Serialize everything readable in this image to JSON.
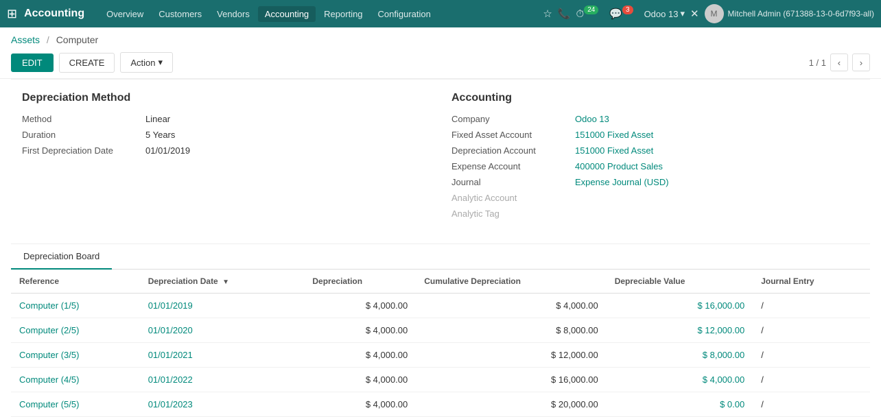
{
  "nav": {
    "brand": "Accounting",
    "links": [
      "Overview",
      "Customers",
      "Vendors",
      "Accounting",
      "Reporting",
      "Configuration"
    ],
    "active_link": "Accounting",
    "odoo_version": "Odoo 13",
    "user_name": "Mitchell Admin (671388-13-0-6d7f93-all)",
    "notification_count": "24",
    "message_count": "3"
  },
  "breadcrumb": {
    "parent": "Assets",
    "current": "Computer"
  },
  "toolbar": {
    "edit_label": "EDIT",
    "create_label": "CREATE",
    "action_label": "Action",
    "pagination": "1 / 1"
  },
  "depreciation_method": {
    "title": "Depreciation Method",
    "fields": {
      "method_label": "Method",
      "method_value": "Linear",
      "duration_label": "Duration",
      "duration_value": "5 Years",
      "first_date_label": "First Depreciation Date",
      "first_date_value": "01/01/2019"
    }
  },
  "accounting": {
    "title": "Accounting",
    "fields": {
      "company_label": "Company",
      "company_value": "Odoo 13",
      "fixed_asset_label": "Fixed Asset Account",
      "fixed_asset_value": "151000 Fixed Asset",
      "depreciation_account_label": "Depreciation Account",
      "depreciation_account_value": "151000 Fixed Asset",
      "expense_account_label": "Expense Account",
      "expense_account_value": "400000 Product Sales",
      "journal_label": "Journal",
      "journal_value": "Expense Journal (USD)",
      "analytic_account_label": "Analytic Account",
      "analytic_account_value": "",
      "analytic_tag_label": "Analytic Tag",
      "analytic_tag_value": ""
    }
  },
  "tab": {
    "label": "Depreciation Board"
  },
  "table": {
    "columns": [
      {
        "key": "reference",
        "label": "Reference",
        "align": "left"
      },
      {
        "key": "depreciation_date",
        "label": "Depreciation Date",
        "align": "left",
        "sorted": true
      },
      {
        "key": "depreciation",
        "label": "Depreciation",
        "align": "right"
      },
      {
        "key": "cumulative",
        "label": "Cumulative Depreciation",
        "align": "right"
      },
      {
        "key": "depreciable",
        "label": "Depreciable Value",
        "align": "right"
      },
      {
        "key": "journal_entry",
        "label": "Journal Entry",
        "align": "left"
      }
    ],
    "rows": [
      {
        "reference": "Computer (1/5)",
        "depreciation_date": "01/01/2019",
        "depreciation": "$ 4,000.00",
        "cumulative": "$ 4,000.00",
        "depreciable": "$ 16,000.00",
        "journal_entry": "/"
      },
      {
        "reference": "Computer (2/5)",
        "depreciation_date": "01/01/2020",
        "depreciation": "$ 4,000.00",
        "cumulative": "$ 8,000.00",
        "depreciable": "$ 12,000.00",
        "journal_entry": "/"
      },
      {
        "reference": "Computer (3/5)",
        "depreciation_date": "01/01/2021",
        "depreciation": "$ 4,000.00",
        "cumulative": "$ 12,000.00",
        "depreciable": "$ 8,000.00",
        "journal_entry": "/"
      },
      {
        "reference": "Computer (4/5)",
        "depreciation_date": "01/01/2022",
        "depreciation": "$ 4,000.00",
        "cumulative": "$ 16,000.00",
        "depreciable": "$ 4,000.00",
        "journal_entry": "/"
      },
      {
        "reference": "Computer (5/5)",
        "depreciation_date": "01/01/2023",
        "depreciation": "$ 4,000.00",
        "cumulative": "$ 20,000.00",
        "depreciable": "$ 0.00",
        "journal_entry": "/"
      }
    ]
  },
  "colors": {
    "teal": "#00897b",
    "nav_bg": "#1a6e6e"
  }
}
